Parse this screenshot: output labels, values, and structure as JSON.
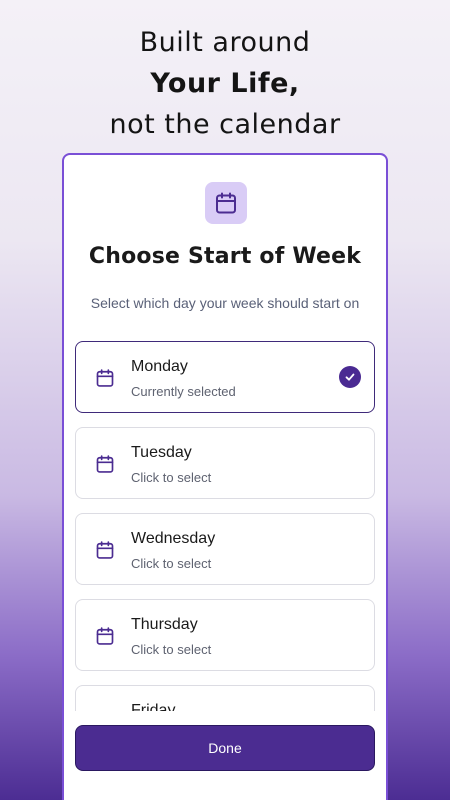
{
  "headline": {
    "line1": "Built around",
    "line2": "Your Life,",
    "line3": "not the calendar"
  },
  "card": {
    "icon": "calendar-icon",
    "title": "Choose Start of Week",
    "subtitle": "Select which day your week should start on"
  },
  "days": [
    {
      "label": "Monday",
      "status": "Currently selected",
      "selected": true
    },
    {
      "label": "Tuesday",
      "status": "Click to select",
      "selected": false
    },
    {
      "label": "Wednesday",
      "status": "Click to select",
      "selected": false
    },
    {
      "label": "Thursday",
      "status": "Click to select",
      "selected": false
    },
    {
      "label": "Friday",
      "status": "",
      "selected": false
    }
  ],
  "done_label": "Done",
  "colors": {
    "accent": "#4b2c91",
    "card_border": "#7a4fd6",
    "icon_bg": "#d9ccf6"
  }
}
